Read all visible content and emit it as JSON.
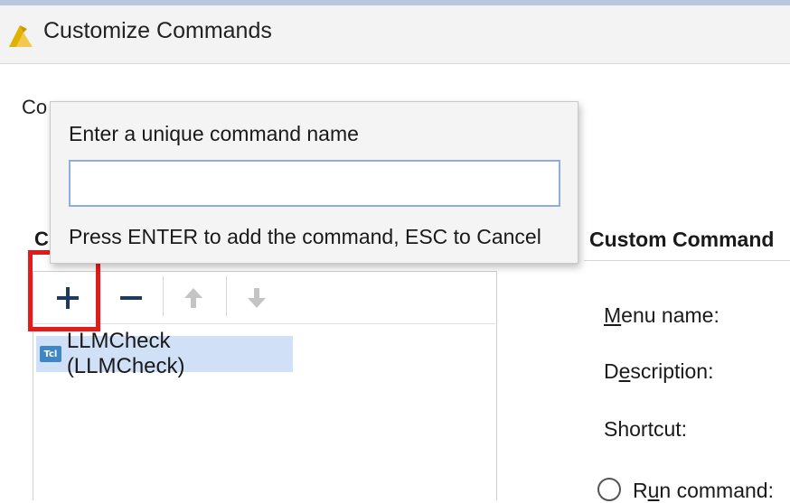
{
  "window": {
    "title": "Customize Commands"
  },
  "background": {
    "intro_text_partial": "Co",
    "left_header_partial": "C"
  },
  "popup": {
    "title": "Enter a unique command name",
    "input_value": "",
    "hint": "Press ENTER to add the command, ESC to Cancel"
  },
  "toolbar": {
    "buttons": [
      {
        "icon": "plus-icon",
        "highlighted": true
      },
      {
        "icon": "minus-icon"
      },
      {
        "icon": "arrow-up-icon",
        "disabled": true
      },
      {
        "icon": "arrow-down-icon",
        "disabled": true
      }
    ]
  },
  "commands": [
    {
      "icon": "tcl-icon",
      "icon_label": "Tcl",
      "label": "LLMCheck (LLMCheck)",
      "selected": true
    }
  ],
  "custom_command": {
    "header": "Custom Command",
    "fields": {
      "menu_name": {
        "mnemonic": "M",
        "rest": "enu name:"
      },
      "description": {
        "pre": "D",
        "mnemonic": "e",
        "rest": "scription:"
      },
      "shortcut": "Shortcut:",
      "run_command": {
        "mnemonic": "u",
        "pre": "R",
        "rest": "n command:"
      }
    }
  },
  "colors": {
    "accent": "#3e86c4",
    "selection": "#cfe0f7",
    "highlight": "#e41b1b",
    "icon_dark": "#1f3a5f"
  }
}
